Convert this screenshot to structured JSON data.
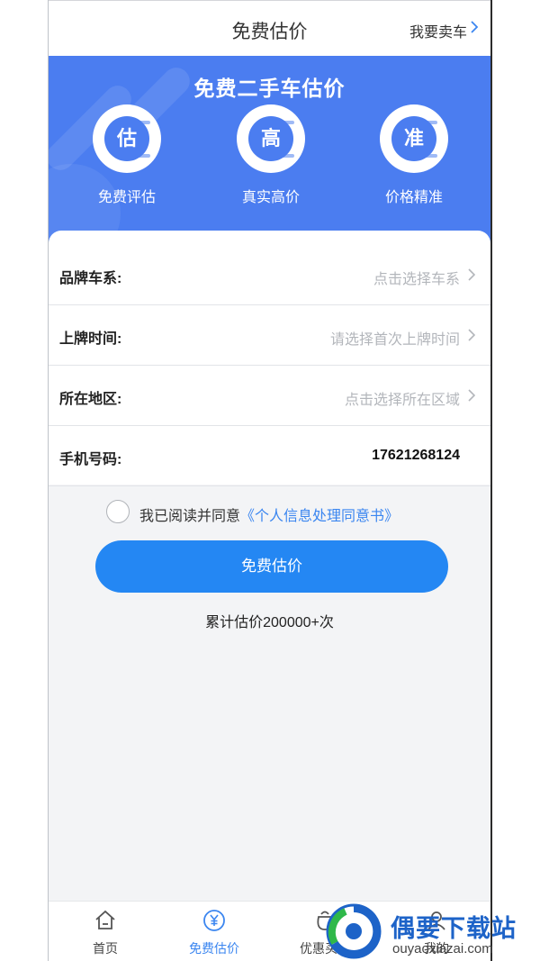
{
  "header": {
    "title": "免费估价",
    "sell_link": "我要卖车"
  },
  "banner": {
    "title": "免费二手车估价",
    "features": [
      {
        "char": "估",
        "label": "免费评估"
      },
      {
        "char": "高",
        "label": "真实高价"
      },
      {
        "char": "准",
        "label": "价格精准"
      }
    ]
  },
  "form": {
    "rows": [
      {
        "label": "品牌车系:",
        "value": "点击选择车系"
      },
      {
        "label": "上牌时间:",
        "value": "请选择首次上牌时间"
      },
      {
        "label": "所在地区:",
        "value": "点击选择所在区域"
      },
      {
        "label": "手机号码:",
        "value": "17621268124"
      }
    ]
  },
  "consent": {
    "text": "我已阅读并同意",
    "link": "《个人信息处理同意书》",
    "checked": false
  },
  "cta": {
    "label": "免费估价"
  },
  "stats": {
    "count_text": "累计估价200000+次"
  },
  "tabbar": {
    "items": [
      {
        "label": "首页",
        "icon": "home-icon"
      },
      {
        "label": "免费估价",
        "icon": "yen-icon",
        "active": true
      },
      {
        "label": "优惠买车",
        "icon": "bag-icon"
      },
      {
        "label": "我的",
        "icon": "user-icon"
      }
    ]
  },
  "watermark": {
    "cn": "偶要下载站",
    "en": "ouyaoxiazai.com"
  },
  "colors": {
    "primary": "#2487f3",
    "banner": "#4b7df0",
    "link": "#3b86f0"
  }
}
